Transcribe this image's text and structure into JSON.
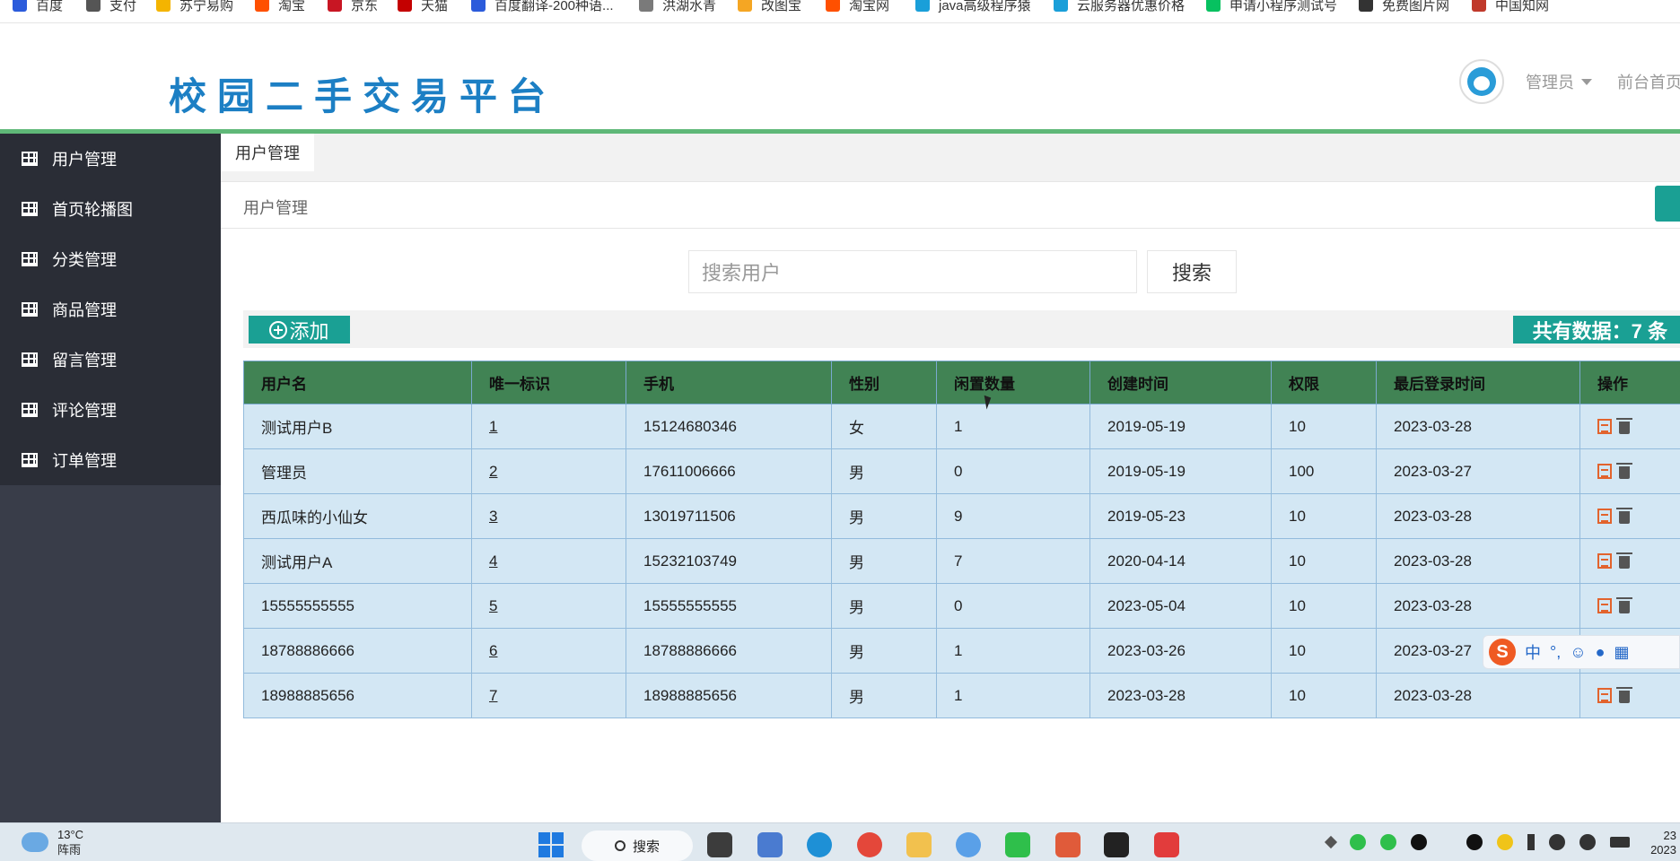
{
  "bookmarks": [
    {
      "label": "百度",
      "color": "#2b5bdb"
    },
    {
      "label": "支付",
      "color": "#555555"
    },
    {
      "label": "苏宁易购",
      "color": "#f4b400"
    },
    {
      "label": "淘宝",
      "color": "#ff5000"
    },
    {
      "label": "京东",
      "color": "#c81623"
    },
    {
      "label": "天猫",
      "color": "#c40000"
    },
    {
      "label": "百度翻译-200种语...",
      "color": "#2b5bdb"
    },
    {
      "label": "洪湖水青",
      "color": "#7a7a7a"
    },
    {
      "label": "改图宝",
      "color": "#f5a623"
    },
    {
      "label": "淘宝网",
      "color": "#ff5000"
    },
    {
      "label": "java高级程序猿",
      "color": "#1a9fd9"
    },
    {
      "label": "云服务器优惠价格",
      "color": "#1a9fd9"
    },
    {
      "label": "申请小程序测试号",
      "color": "#07c160"
    },
    {
      "label": "免费图片网",
      "color": "#333333"
    },
    {
      "label": "中国知网",
      "color": "#c0392b"
    }
  ],
  "header": {
    "brand": "校园二手交易平台",
    "admin_label": "管理员",
    "front_link": "前台首页"
  },
  "sidebar": {
    "items": [
      {
        "label": "用户管理"
      },
      {
        "label": "首页轮播图"
      },
      {
        "label": "分类管理"
      },
      {
        "label": "商品管理"
      },
      {
        "label": "留言管理"
      },
      {
        "label": "评论管理"
      },
      {
        "label": "订单管理"
      }
    ]
  },
  "tabs": {
    "active": "用户管理"
  },
  "breadcrumb": "用户管理",
  "search": {
    "placeholder": "搜索用户",
    "button": "搜索"
  },
  "toolbar": {
    "add_label": "添加",
    "total_label": "共有数据：7 条"
  },
  "table": {
    "columns": [
      "用户名",
      "唯一标识",
      "手机",
      "性别",
      "闲置数量",
      "创建时间",
      "权限",
      "最后登录时间",
      "操作"
    ],
    "rows": [
      [
        "测试用户B",
        "1",
        "15124680346",
        "女",
        "1",
        "2019-05-19",
        "10",
        "2023-03-28"
      ],
      [
        "管理员",
        "2",
        "17611006666",
        "男",
        "0",
        "2019-05-19",
        "100",
        "2023-03-27"
      ],
      [
        "西瓜味的小仙女",
        "3",
        "13019711506",
        "男",
        "9",
        "2019-05-23",
        "10",
        "2023-03-28"
      ],
      [
        "测试用户A",
        "4",
        "15232103749",
        "男",
        "7",
        "2020-04-14",
        "10",
        "2023-03-28"
      ],
      [
        "15555555555",
        "5",
        "15555555555",
        "男",
        "0",
        "2023-05-04",
        "10",
        "2023-03-28"
      ],
      [
        "18788886666",
        "6",
        "18788886666",
        "男",
        "1",
        "2023-03-26",
        "10",
        "2023-03-27"
      ],
      [
        "18988885656",
        "7",
        "18988885656",
        "男",
        "1",
        "2023-03-28",
        "10",
        "2023-03-28"
      ]
    ]
  },
  "ime": {
    "mode": "中",
    "punct": "°,"
  },
  "taskbar": {
    "weather_temp": "13°C",
    "weather_desc": "阵雨",
    "search_label": "搜索",
    "clock_time": "23",
    "clock_date": "2023"
  },
  "colors": {
    "accent": "#1aa094",
    "sidebar": "#393d49",
    "table_header": "#418354",
    "table_cell": "#d3e7f4",
    "brand": "#1c7fc4"
  }
}
